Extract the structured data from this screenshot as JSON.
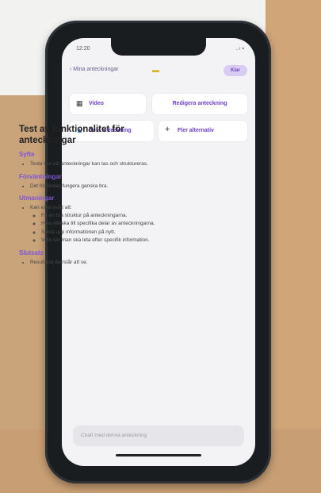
{
  "status": {
    "time": "12:20",
    "icons": "..‹ ▪"
  },
  "navbar": {
    "back_label": "‹ Mina anteckningar",
    "done_label": "Klar"
  },
  "actions": [
    {
      "label": "Video",
      "icon": "video-icon"
    },
    {
      "label": "Redigera anteckning",
      "icon": ""
    },
    {
      "label": "Dela anteckning",
      "icon": "share-icon"
    },
    {
      "label": "Fler alternativ",
      "icon": "plus-icon"
    }
  ],
  "note": {
    "title": "Test av funktionalitet för anteckningar",
    "sections": [
      {
        "heading": "Syfte",
        "items": [
          "Testa hur väl anteckningar kan tas och struktureras."
        ]
      },
      {
        "heading": "Förväntningar",
        "items": [
          "Det förväntas fungera ganska bra."
        ]
      },
      {
        "heading": "Utmaningar",
        "items": [
          "Kan vara svårt att:"
        ],
        "subitems": [
          "Få en bra struktur på anteckningarna.",
          "Hitta tillbaka till specifika delar av anteckningarna.",
          "Spela upp informationen på nytt.",
          "Veta var man ska leta efter specifik information."
        ]
      },
      {
        "heading": "Slutsats",
        "items": [
          "Resultatet återstår att se."
        ]
      }
    ]
  },
  "chat": {
    "placeholder": "Chatt med denna anteckning"
  },
  "colors": {
    "accent": "#6d3fc8",
    "heading": "#7d55d6",
    "screen_bg": "#f3f3f6"
  }
}
